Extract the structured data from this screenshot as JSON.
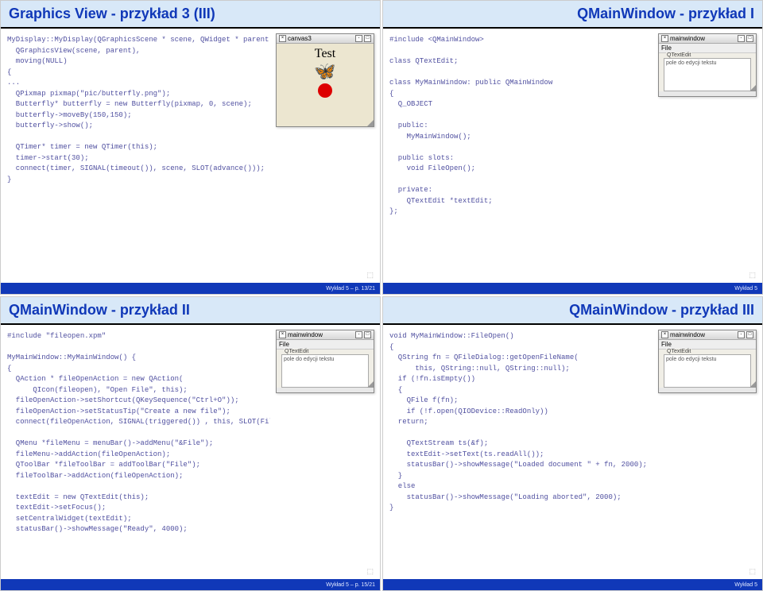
{
  "slides": {
    "s1": {
      "title": "Graphics View - przykład 3 (III)",
      "code": "MyDisplay::MyDisplay(QGraphicsScene * scene, QWidget * parent):\n  QGraphicsView(scene, parent),\n  moving(NULL)\n{\n...\n  QPixmap pixmap(\"pic/butterfly.png\");\n  Butterfly* butterfly = new Butterfly(pixmap, 0, scene);\n  butterfly->moveBy(150,150);\n  butterfly->show();\n\n  QTimer* timer = new QTimer(this);\n  timer->start(30);\n  connect(timer, SIGNAL(timeout()), scene, SLOT(advance()));\n}",
      "win_title": "canvas3",
      "canvas_text": "Test",
      "footer": "Wykład 5 – p. 13/21"
    },
    "s2": {
      "title": "QMainWindow - przykład I",
      "code": "#include <QMainWindow>\n\nclass QTextEdit;\n\nclass MyMainWindow: public QMainWindow\n{\n  Q_OBJECT\n\n  public:\n    MyMainWindow();\n\n  public slots:\n    void FileOpen();\n\n  private:\n    QTextEdit *textEdit;\n};",
      "win_title": "mainwindow",
      "menu": "File",
      "edit_label": "QTextEdit",
      "edit_hint": "pole do edycji tekstu",
      "footer": "Wykład 5"
    },
    "s3": {
      "title": "QMainWindow - przykład II",
      "code": "#include \"fileopen.xpm\"\n\nMyMainWindow::MyMainWindow() {\n{\n  QAction * fileOpenAction = new QAction(\n      QIcon(fileopen), \"Open File\", this);\n  fileOpenAction->setShortcut(QKeySequence(\"Ctrl+O\"));\n  fileOpenAction->setStatusTip(\"Create a new file\");\n  connect(fileOpenAction, SIGNAL(triggered()) , this, SLOT(FileOpen()));\n\n  QMenu *fileMenu = menuBar()->addMenu(\"&File\");\n  fileMenu->addAction(fileOpenAction);\n  QToolBar *fileToolBar = addToolBar(\"File\");\n  fileToolBar->addAction(fileOpenAction);\n\n  textEdit = new QTextEdit(this);\n  textEdit->setFocus();\n  setCentralWidget(textEdit);\n  statusBar()->showMessage(\"Ready\", 4000);\n",
      "win_title": "mainwindow",
      "menu": "File",
      "edit_label": "QTextEdit",
      "edit_hint": "pole do edycji tekstu",
      "footer": "Wykład 5 – p. 15/21"
    },
    "s4": {
      "title": "QMainWindow - przykład III",
      "code": "void MyMainWindow::FileOpen()\n{\n  QString fn = QFileDialog::getOpenFileName(\n      this, QString::null, QString::null);\n  if (!fn.isEmpty())\n  {\n    QFile f(fn);\n    if (!f.open(QIODevice::ReadOnly))\n  return;\n\n    QTextStream ts(&f);\n    textEdit->setText(ts.readAll());\n    statusBar()->showMessage(\"Loaded document \" + fn, 2000);\n  }\n  else\n    statusBar()->showMessage(\"Loading aborted\", 2000);\n}",
      "win_title": "mainwindow",
      "menu": "File",
      "edit_label": "QTextEdit",
      "edit_hint": "pole do edycji tekstu",
      "footer": "Wykład 5"
    }
  }
}
